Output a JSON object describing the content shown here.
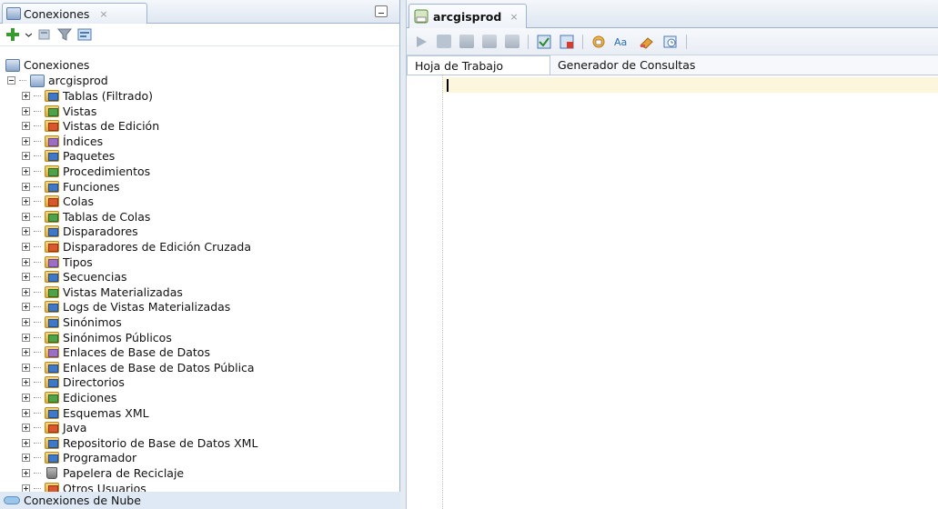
{
  "connections_panel": {
    "tab_label": "Conexiones",
    "tab_close": "×",
    "root_label": "Conexiones",
    "connection_label": "arcgisprod",
    "items": [
      {
        "label": "Tablas (Filtrado)",
        "icon": "tables-folder-icon"
      },
      {
        "label": "Vistas",
        "icon": "views-folder-icon"
      },
      {
        "label": "Vistas de Edición",
        "icon": "edition-views-folder-icon"
      },
      {
        "label": "Índices",
        "icon": "indexes-folder-icon"
      },
      {
        "label": "Paquetes",
        "icon": "packages-folder-icon"
      },
      {
        "label": "Procedimientos",
        "icon": "procedures-folder-icon"
      },
      {
        "label": "Funciones",
        "icon": "functions-folder-icon"
      },
      {
        "label": "Colas",
        "icon": "queues-folder-icon"
      },
      {
        "label": "Tablas de Colas",
        "icon": "queue-tables-folder-icon"
      },
      {
        "label": "Disparadores",
        "icon": "triggers-folder-icon"
      },
      {
        "label": "Disparadores de Edición Cruzada",
        "icon": "crossedition-triggers-folder-icon"
      },
      {
        "label": "Tipos",
        "icon": "types-folder-icon"
      },
      {
        "label": "Secuencias",
        "icon": "sequences-folder-icon"
      },
      {
        "label": "Vistas Materializadas",
        "icon": "materialized-views-folder-icon"
      },
      {
        "label": "Logs de Vistas Materializadas",
        "icon": "materialized-view-logs-folder-icon"
      },
      {
        "label": "Sinónimos",
        "icon": "synonyms-folder-icon"
      },
      {
        "label": "Sinónimos Públicos",
        "icon": "public-synonyms-folder-icon"
      },
      {
        "label": "Enlaces de Base de Datos",
        "icon": "db-links-folder-icon"
      },
      {
        "label": "Enlaces de Base de Datos Pública",
        "icon": "public-db-links-folder-icon"
      },
      {
        "label": "Directorios",
        "icon": "directories-folder-icon"
      },
      {
        "label": "Ediciones",
        "icon": "editions-folder-icon"
      },
      {
        "label": "Esquemas XML",
        "icon": "xml-schemas-folder-icon"
      },
      {
        "label": "Java",
        "icon": "java-folder-icon"
      },
      {
        "label": "Repositorio de Base de Datos XML",
        "icon": "xml-db-repository-folder-icon"
      },
      {
        "label": "Programador",
        "icon": "scheduler-folder-icon"
      },
      {
        "label": "Papelera de Reciclaje",
        "icon": "recycle-bin-icon"
      },
      {
        "label": "Otros Usuarios",
        "icon": "other-users-folder-icon"
      }
    ],
    "cloud_label": "Conexiones de Nube"
  },
  "editor": {
    "tab_label": "arcgisprod",
    "tab_close": "×",
    "subtabs": [
      "Hoja de Trabajo",
      "Generador de Consultas"
    ]
  },
  "colors": {
    "accent_blue": "#9fb3cc",
    "current_line": "#fbf6dc",
    "bottom_row_bg": "#dfe9f5"
  }
}
